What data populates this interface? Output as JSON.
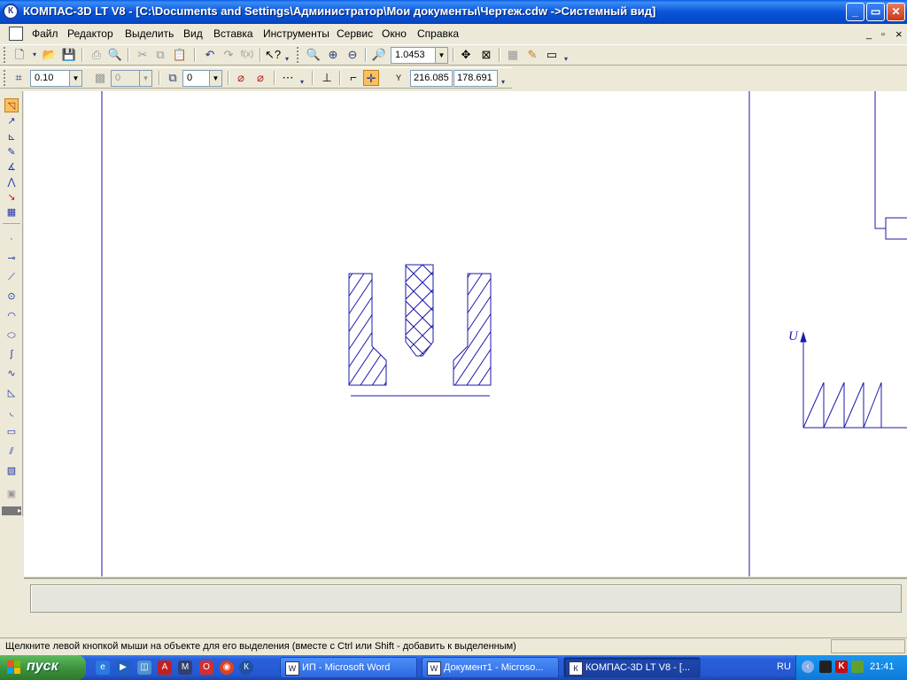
{
  "window": {
    "title": "КОМПАС-3D LT V8 - [C:\\Documents and Settings\\Администратор\\Мои документы\\Чертеж.cdw ->Системный вид]",
    "app_icon": "К",
    "controls": {
      "minimize": "_",
      "maximize": "▭",
      "close": "✕"
    }
  },
  "menu": {
    "items": [
      "Файл",
      "Редактор",
      "Выделить",
      "Вид",
      "Вставка",
      "Инструменты",
      "Сервис",
      "Окно",
      "Справка"
    ],
    "mdi_controls": {
      "minimize": "_",
      "restore": "▫",
      "close": "×"
    }
  },
  "toolbar1": {
    "zoom_value": "1.0453"
  },
  "toolbar2": {
    "step_value": "0.10",
    "layer_value": "0",
    "style_value": "0",
    "coord_label": "Y",
    "x_value": "216.085",
    "y_value": "178.691"
  },
  "drawing": {
    "axis_label": "U"
  },
  "status": {
    "text": "Щелкните левой кнопкой мыши на объекте для его выделения (вместе с Ctrl или Shift - добавить к выделенным)"
  },
  "taskbar": {
    "start_label": "пуск",
    "tasks": [
      {
        "label": "ИП - Microsoft Word",
        "icon": "W"
      },
      {
        "label": "Документ1 - Microso...",
        "icon": "W"
      },
      {
        "label": "КОМПАС-3D LT V8 - [...",
        "icon": "К"
      }
    ],
    "language": "RU",
    "clock": "21:41"
  },
  "colors": {
    "drawing_stroke": "#1a1aa8",
    "titlebar": "#0a5ce4",
    "taskbar": "#2457d2",
    "start_button": "#3a8f3a"
  }
}
